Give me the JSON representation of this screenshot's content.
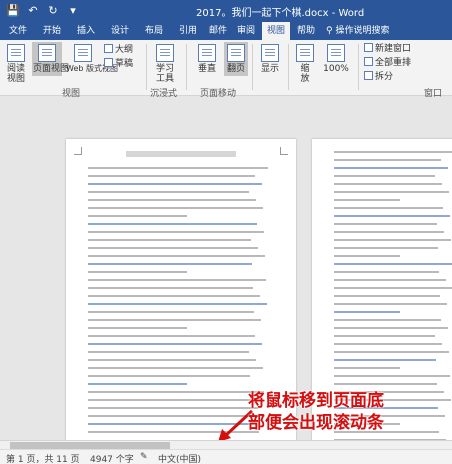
{
  "titlebar": {
    "title": "2017。我们一起下个棋.docx  -  Word",
    "quick_access": [
      "save",
      "undo",
      "redo",
      "customize"
    ]
  },
  "tabs": [
    {
      "label": "文件"
    },
    {
      "label": "开始"
    },
    {
      "label": "插入"
    },
    {
      "label": "设计"
    },
    {
      "label": "布局"
    },
    {
      "label": "引用"
    },
    {
      "label": "邮件"
    },
    {
      "label": "审阅"
    },
    {
      "label": "视图",
      "active": true
    },
    {
      "label": "帮助"
    }
  ],
  "tell_me": "操作说明搜索",
  "ribbon": {
    "views": {
      "read_mode": "阅读\n视图",
      "print_layout": "页面视图",
      "web_layout": "Web 版式视图",
      "outline": "大纲",
      "draft": "草稿",
      "group": "视图"
    },
    "immersive": {
      "learning_tools": "学习\n工具",
      "group": "沉浸式"
    },
    "page_movement": {
      "vertical": "垂直",
      "side_to_side": "翻页",
      "group": "页面移动"
    },
    "show": {
      "label": "显示"
    },
    "zoom": {
      "zoom": "缩\n放",
      "percent": "100%"
    },
    "window": {
      "new_window": "新建窗口",
      "arrange_all": "全部重排",
      "split": "拆分",
      "group": "窗口"
    }
  },
  "annotation": {
    "line1": "将鼠标移到页面底",
    "line2": "部便会出现滚动条",
    "color": "#d30f0f"
  },
  "status": {
    "page": "第 1 页，共 11 页",
    "words": "4947 个字",
    "language": "中文(中国)"
  },
  "colors": {
    "accent": "#2b579a"
  }
}
